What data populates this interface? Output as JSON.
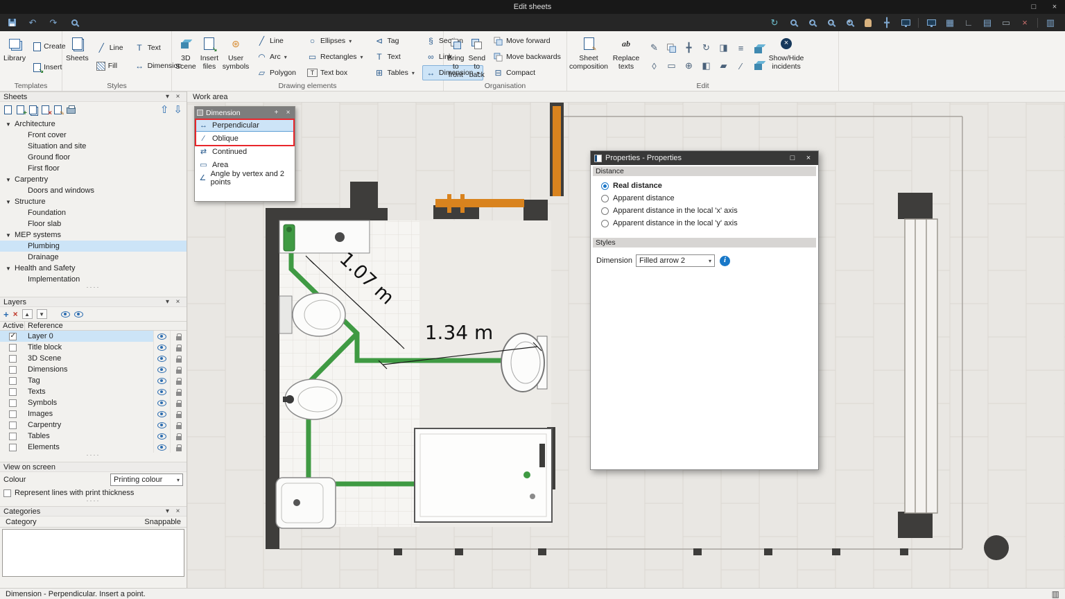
{
  "titlebar": {
    "title": "Edit sheets"
  },
  "ribbon": {
    "templates": {
      "label": "Templates",
      "library": "Library",
      "create": "Create",
      "insert": "Insert"
    },
    "styles": {
      "label": "Styles",
      "sheets": "Sheets",
      "fill": "Fill",
      "line": "Line",
      "text": "Text",
      "dimension": "Dimension"
    },
    "drawing": {
      "label": "Drawing elements",
      "scene": "3D Scene",
      "insert_files": "Insert files",
      "user_symbols": "User symbols",
      "items": [
        "Line",
        "Arc",
        "Polygon",
        "Ellipses",
        "Rectangles",
        "Text box",
        "Tag",
        "Text",
        "Tables",
        "Section",
        "Link",
        "Dimension"
      ]
    },
    "organisation": {
      "label": "Organisation",
      "bring_front": "Bring to front",
      "send_back": "Send to back",
      "move_forward": "Move forward",
      "move_backwards": "Move backwards",
      "compact": "Compact"
    },
    "edit": {
      "label": "Edit",
      "sheet_composition": "Sheet composition",
      "replace_texts": "Replace texts",
      "show_hide": "Show/Hide incidents"
    }
  },
  "sheets_panel": {
    "title": "Sheets",
    "tree": [
      "Architecture",
      "Front cover",
      "Situation and site",
      "Ground floor",
      "First floor",
      "Carpentry",
      "Doors and windows",
      "Structure",
      "Foundation",
      "Floor slab",
      "MEP systems",
      "Plumbing",
      "Drainage",
      "Health and Safety",
      "Implementation"
    ]
  },
  "layers_panel": {
    "title": "Layers",
    "col_active": "Active",
    "col_reference": "Reference",
    "rows": [
      "Layer 0",
      "Title block",
      "3D Scene",
      "Dimensions",
      "Tag",
      "Texts",
      "Symbols",
      "Images",
      "Carpentry",
      "Tables",
      "Elements"
    ]
  },
  "view_panel": {
    "title": "View on screen",
    "colour_label": "Colour",
    "colour_value": "Printing colour",
    "thickness_label": "Represent lines with print thickness"
  },
  "categories_panel": {
    "title": "Categories",
    "col_category": "Category",
    "col_snappable": "Snappable"
  },
  "workarea": {
    "label": "Work area",
    "dim1": "1.07 m",
    "dim2": "1.34 m",
    "toolbar": {
      "title": "Dimension",
      "items": [
        "Perpendicular",
        "Oblique",
        "Continued",
        "Area",
        "Angle by vertex and 2 points"
      ]
    }
  },
  "properties": {
    "title": "Properties - Properties",
    "distance_header": "Distance",
    "options": [
      "Real distance",
      "Apparent distance",
      "Apparent distance in the local 'x' axis",
      "Apparent distance in the local 'y' axis"
    ],
    "styles_header": "Styles",
    "dimension_label": "Dimension",
    "dimension_value": "Filled arrow 2"
  },
  "statusbar": {
    "text": "Dimension - Perpendicular. Insert a point."
  },
  "icons": {
    "restore": "□",
    "close": "×",
    "undo": "↶",
    "redo": "↷",
    "menu": "▾",
    "chevron": "▾",
    "pin": "+",
    "up": "⇧",
    "down": "⇩",
    "tri_up": "▲",
    "tri_down": "▼",
    "plus": "+",
    "cross": "×",
    "line": "╱",
    "arc": "◠",
    "polygon": "▱",
    "ellipse": "○",
    "rect": "▭",
    "tag": "⊲",
    "table": "⊞",
    "section": "§",
    "link": "∞",
    "dim": "↔",
    "text_t": "T",
    "pencil": "✎",
    "move": "╋",
    "rotate": "↻",
    "mirror": "◨",
    "trim": "◊",
    "align": "≡",
    "node": "⊕",
    "stretch": "◧",
    "hatch2": "▰",
    "oblique": "∕",
    "continued": "⇄",
    "area": "▭",
    "angle": "∠",
    "perp": "↔",
    "refresh": "↻",
    "extents": "╋",
    "grid": "▤",
    "ruler": "∟",
    "columns": "▥",
    "board": "▦",
    "bubble": "▭",
    "info": "i",
    "compact": "⊟",
    "dots": "····"
  }
}
